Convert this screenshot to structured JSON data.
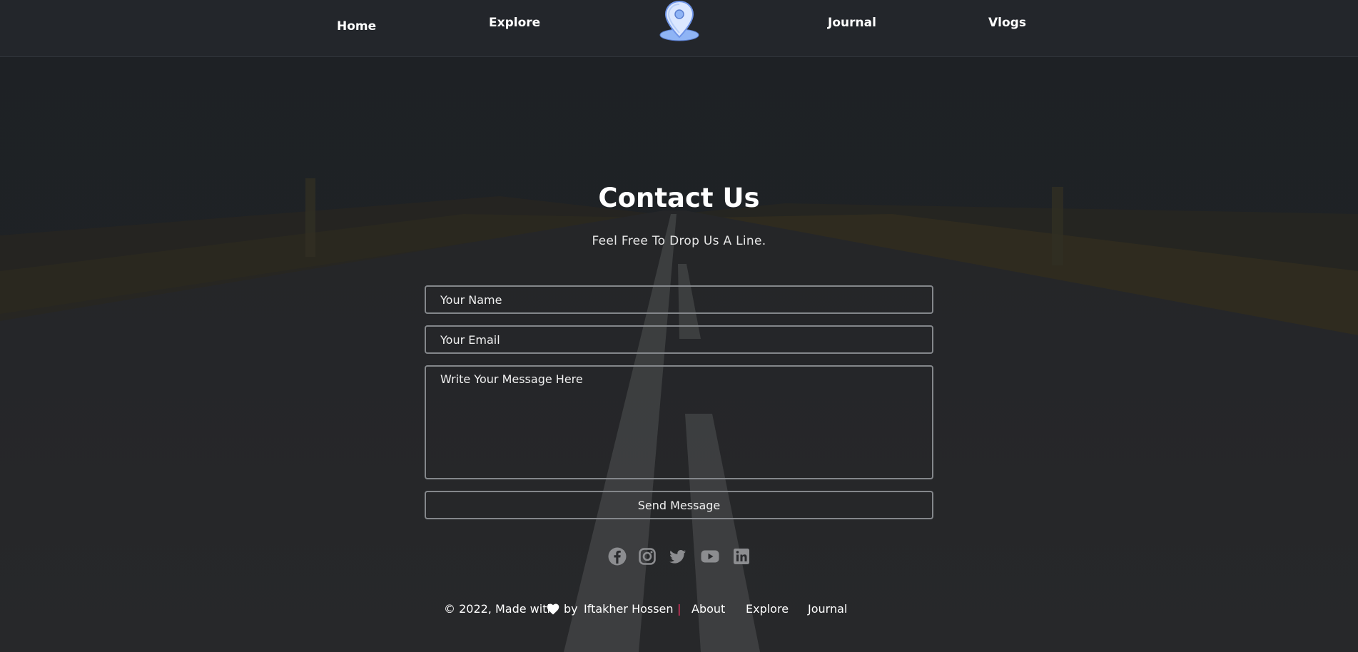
{
  "nav": {
    "home": "Home",
    "explore": "Explore",
    "journal": "Journal",
    "vlogs": "Vlogs",
    "logo_icon": "map-pin-icon"
  },
  "contact": {
    "title": "Contact Us",
    "subtitle": "Feel Free To Drop Us A Line.",
    "name_placeholder": "Your Name",
    "email_placeholder": "Your Email",
    "message_placeholder": "Write Your Message Here",
    "send_label": "Send Message"
  },
  "socials": [
    {
      "icon": "facebook-icon"
    },
    {
      "icon": "instagram-icon"
    },
    {
      "icon": "twitter-icon"
    },
    {
      "icon": "youtube-icon"
    },
    {
      "icon": "linkedin-icon"
    }
  ],
  "footer": {
    "copyright": "© 2022, Made with",
    "heart_icon": "heart-icon",
    "by": "by",
    "author": "Iftakher Hossen",
    "separator": "|",
    "about": "About",
    "explore": "Explore",
    "journal": "Journal"
  },
  "colors": {
    "background": "#23262b",
    "field_border": "#84878b",
    "logo_blue": "#8fb4f5",
    "separator": "#ff3366"
  }
}
